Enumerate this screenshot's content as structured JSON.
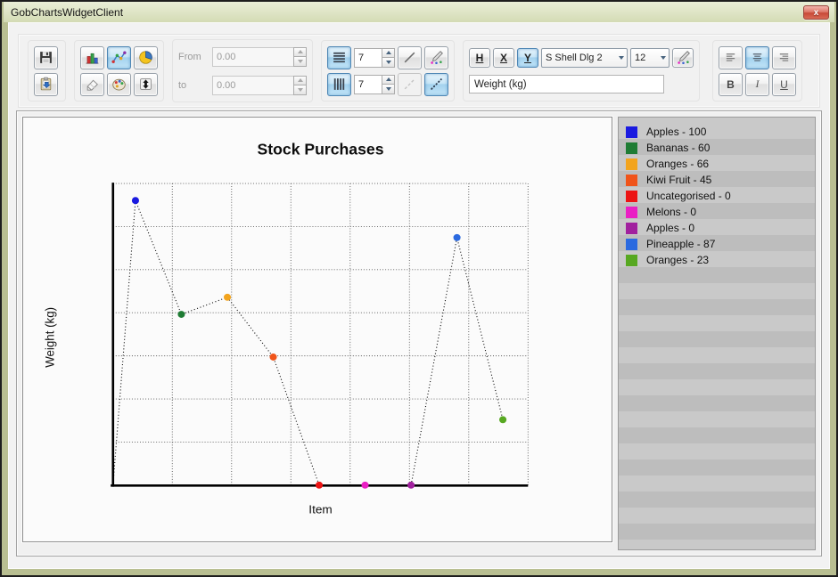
{
  "window": {
    "title": "GobChartsWidgetClient",
    "close_label": "x"
  },
  "toolbar": {
    "range": {
      "from_label": "From",
      "from_value": "0.00",
      "to_label": "to",
      "to_value": "0.00"
    },
    "grid": {
      "h_count": "7",
      "v_count": "7"
    },
    "text": {
      "h": "H",
      "x": "X",
      "y": "Y",
      "font": "S Shell Dlg 2",
      "size": "12",
      "label_value": "Weight (kg)"
    },
    "format": {
      "bold": "B",
      "italic": "I",
      "underline": "U"
    }
  },
  "icons": [
    "save-icon",
    "paste-icon",
    "bar-chart-icon",
    "line-chart-icon",
    "pie-chart-icon",
    "eraser-icon",
    "palette-icon",
    "export-icon",
    "h-grid-icon",
    "v-grid-icon",
    "solid-line-icon",
    "dashed-line-icon",
    "dotted-line-icon",
    "pen-color-icon",
    "align-left-icon",
    "align-center-icon",
    "align-right-icon"
  ],
  "legend": {
    "items": [
      {
        "label": "Apples - 100",
        "color": "#1a1ae0"
      },
      {
        "label": "Bananas - 60",
        "color": "#1f7c34"
      },
      {
        "label": "Oranges - 66",
        "color": "#f2a41e"
      },
      {
        "label": "Kiwi Fruit - 45",
        "color": "#f0541a"
      },
      {
        "label": "Uncategorised - 0",
        "color": "#ec1414"
      },
      {
        "label": "Melons - 0",
        "color": "#ea1fc4"
      },
      {
        "label": "Apples - 0",
        "color": "#a1219e"
      },
      {
        "label": "Pineapple - 87",
        "color": "#2b6ae0"
      },
      {
        "label": "Oranges - 23",
        "color": "#57a821"
      }
    ]
  },
  "chart_data": {
    "type": "line",
    "title": "Stock Purchases",
    "xlabel": "Item",
    "ylabel": "Weight (kg)",
    "categories": [
      "Apples",
      "Bananas",
      "Oranges",
      "Kiwi Fruit",
      "Uncategorised",
      "Melons",
      "Apples",
      "Pineapple",
      "Oranges"
    ],
    "values": [
      100,
      60,
      66,
      45,
      0,
      0,
      0,
      87,
      23
    ],
    "point_colors": [
      "#1a1ae0",
      "#1f7c34",
      "#f2a41e",
      "#f0541a",
      "#ec1414",
      "#ea1fc4",
      "#a1219e",
      "#2b6ae0",
      "#57a821"
    ],
    "line_style": "dotted",
    "line_color": "#000000",
    "starts_at_origin": true,
    "ylim": [
      0,
      106
    ],
    "grid": {
      "h_lines": 7,
      "v_lines": 7,
      "style": "dotted"
    },
    "legend_position": "right-panel"
  }
}
